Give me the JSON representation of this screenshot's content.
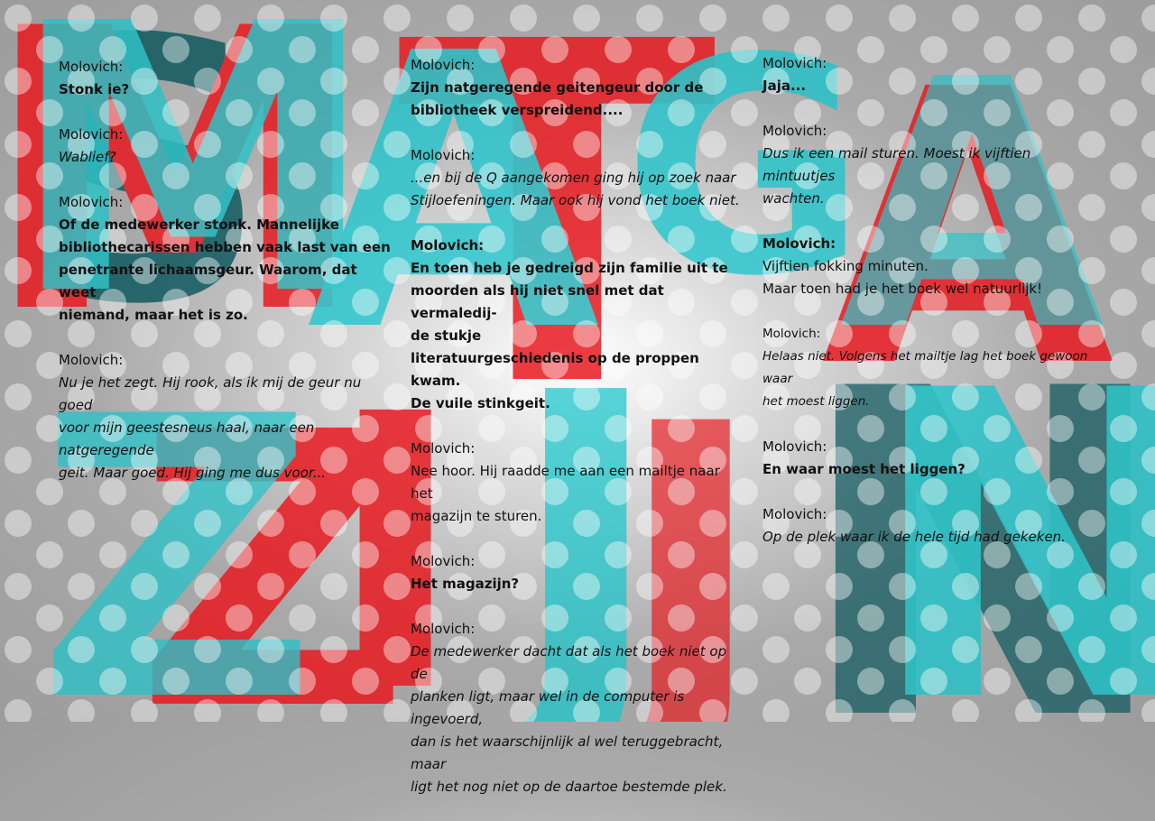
{
  "background": {
    "colors": {
      "cyan": "#19c6cc",
      "red": "#e8191f",
      "dark_teal": "#0f5a60",
      "gray": "#a9a9a9"
    },
    "letters": [
      "M",
      "A",
      "G",
      "A",
      "Z",
      "I",
      "J",
      "N",
      "S",
      "T"
    ]
  },
  "columns": [
    {
      "entries": [
        {
          "speaker": "Molovich:",
          "speaker_style": "normal",
          "style": "bold",
          "lines": [
            "Stonk ie?"
          ]
        },
        {
          "speaker": "Molovich:",
          "speaker_style": "normal",
          "style": "italic",
          "lines": [
            "Wablief?"
          ]
        },
        {
          "speaker": "Molovich:",
          "speaker_style": "normal",
          "style": "bold",
          "lines": [
            "Of de medewerker stonk. Mannelijke",
            "bibliothecarissen hebben vaak last van een",
            "penetrante lichaamsgeur. Waarom, dat weet",
            "niemand, maar het is zo."
          ]
        },
        {
          "speaker": "Molovich:",
          "speaker_style": "normal",
          "style": "italic",
          "lines": [
            "Nu je het zegt. Hij rook, als ik mij de geur nu goed",
            "voor mijn geestesneus haal, naar een natgeregende",
            "geit. Maar goed. Hij ging me dus voor..."
          ]
        }
      ]
    },
    {
      "entries": [
        {
          "speaker": "Molovich:",
          "speaker_style": "normal",
          "style": "bold",
          "lines": [
            "Zijn natgeregende geitengeur door de",
            "bibliotheek verspreidend...."
          ]
        },
        {
          "speaker": "Molovich:",
          "speaker_style": "normal",
          "style": "italic",
          "lines": [
            "...en bij de Q aangekomen ging hij op zoek naar",
            "Stijloefeningen. Maar ook hij vond het boek niet."
          ]
        },
        {
          "speaker": "Molovich:",
          "speaker_style": "bold",
          "style": "bold",
          "lines": [
            "En toen heb je gedreigd zijn familie uit te",
            "moorden als hij niet snel met dat vermaledij-",
            "de stukje",
            "literatuurgeschiedenis op de proppen kwam.",
            "De vuile stinkgeit."
          ]
        },
        {
          "speaker": "Molovich:",
          "speaker_style": "normal",
          "style": "normal",
          "lines": [
            "Nee hoor. Hij raadde me aan een mailtje naar het",
            "magazijn te sturen."
          ]
        },
        {
          "speaker": "Molovich:",
          "speaker_style": "normal",
          "style": "bold",
          "lines": [
            "Het magazijn?"
          ]
        },
        {
          "speaker": "Molovich:",
          "speaker_style": "normal",
          "style": "italic",
          "lines": [
            "De medewerker dacht dat als het boek niet op de",
            "planken ligt, maar wel in de computer is ingevoerd,",
            "dan is het waarschijnlijk al wel teruggebracht, maar",
            "ligt het nog niet op de daartoe bestemde plek."
          ]
        }
      ]
    },
    {
      "entries": [
        {
          "speaker": "Molovich:",
          "speaker_style": "normal",
          "style": "bold",
          "lines": [
            "Jaja..."
          ]
        },
        {
          "speaker": "Molovich:",
          "speaker_style": "normal",
          "style": "italic",
          "lines": [
            "Dus ik een mail sturen. Moest ik vijftien mintuutjes",
            "wachten."
          ]
        },
        {
          "speaker": "Molovich:",
          "speaker_style": "bold",
          "style": "normal",
          "lines": [
            "Vijftien fokking minuten.",
            "Maar toen had je het boek wel natuurlijk!"
          ]
        },
        {
          "speaker": "Molovich:",
          "speaker_style": "small",
          "style": "italic-small",
          "lines": [
            "Helaas niet. Volgens het mailtje lag het boek gewoon waar",
            "het moest liggen."
          ]
        },
        {
          "speaker": "Molovich:",
          "speaker_style": "normal",
          "style": "bold",
          "lines": [
            "En waar moest het liggen?"
          ]
        },
        {
          "speaker": "Molovich:",
          "speaker_style": "normal",
          "style": "italic",
          "lines": [
            "Op de plek waar ik de hele tijd had gekeken."
          ]
        }
      ]
    }
  ]
}
